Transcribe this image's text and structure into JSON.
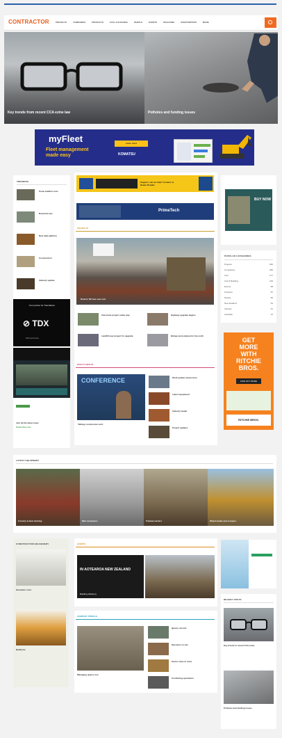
{
  "brand": {
    "logo_text": "CONTRACTOR",
    "accent": "#f06b22",
    "link_blue": "#2a5fa8"
  },
  "nav": {
    "items": [
      "PROJECTS",
      "COMPANIES",
      "PRODUCTS",
      "CIVIL & BUILDING",
      "PEOPLE",
      "EVENTS",
      "MAGAZINE",
      "SUBSCRIPTION",
      "MORE"
    ]
  },
  "hero": [
    {
      "title": "Key trends from recent CCA ezine law",
      "meta": ""
    },
    {
      "title": "Potholes and funding issues",
      "meta": ""
    }
  ],
  "banner1": {
    "title": "myFleet",
    "subtitle_line1": "Fleet management",
    "subtitle_line2": "made easy",
    "button": "Learn more",
    "brand": "KOMATSU"
  },
  "sidebar_left": {
    "heading": "TRENDING",
    "items": [
      "Some builders now",
      "Road bid new",
      "New data platform",
      "Construction",
      "Industry update"
    ]
  },
  "tdx_ad": {
    "top_text": "Your partner for TransDecal",
    "logo": "TDX",
    "bottom_text": "Find out more"
  },
  "ad_subscribe": {
    "line1": "Join all the latest news",
    "line2": "Subscribe now"
  },
  "mid_ads": [
    {
      "text": "Support, can we help? Contact us Dealer Rentals"
    },
    {
      "text": "PrimeTech"
    }
  ],
  "projects_section": {
    "label": "PROJECTS",
    "feature_caption": "Road in NZ was sees end",
    "items": [
      {
        "title": "Fast-track project under way",
        "date": ""
      },
      {
        "title": "Highway upgrade begins",
        "date": ""
      },
      {
        "title": "Landfill new project for upgrade",
        "date": ""
      },
      {
        "title": "Bridge work planned in the north",
        "date": ""
      }
    ]
  },
  "videos_section": {
    "label": "WHAT'S NEW IN",
    "feature_title": "Talking construction tech",
    "feature_caption": "CONFERENCE",
    "items": [
      "Work update shown here",
      "Latest equipment",
      "Industry leader",
      "Project updates"
    ]
  },
  "right_top_ad": {
    "label": "BUY NOW"
  },
  "categories": {
    "heading": "POPULAR CATEGORIES",
    "rows": [
      {
        "name": "Projects",
        "count": "290"
      },
      {
        "name": "Companies",
        "count": "283"
      },
      {
        "name": "Civil",
        "count": "177"
      },
      {
        "name": "Civil & Building",
        "count": "146"
      },
      {
        "name": "Events",
        "count": "98"
      },
      {
        "name": "Products",
        "count": "87"
      },
      {
        "name": "People",
        "count": "66"
      },
      {
        "name": "New Zealand",
        "count": "53"
      },
      {
        "name": "Industry",
        "count": "31"
      },
      {
        "name": "Australia",
        "count": "12"
      }
    ]
  },
  "ritchie_ad": {
    "line1": "GET",
    "line2": "MORE",
    "line3": "WITH",
    "line4": "RITCHIE",
    "line5": "BROS.",
    "button": "FIND OUT MORE",
    "logo": "RITCHIE BROS."
  },
  "latest": {
    "heading": "LATEST EQUIPMENT",
    "tiles": [
      {
        "caption": "Forestry & land clearing"
      },
      {
        "caption": "Mini excavators"
      },
      {
        "caption": "Tracked carriers"
      },
      {
        "caption": "Wheel loader and scrapers"
      }
    ]
  },
  "bottom_left": {
    "heading": "CONSTRUCTION MACHINERY",
    "item1": "Excavator rows",
    "item2": "Bulldozer"
  },
  "bottom_mid": {
    "label": "EVENTS",
    "feature_caption": "IN AOTEAROA NEW ZEALAND",
    "feature_title": "Building efficiency",
    "side_caption": ""
  },
  "bottom_mid2": {
    "label": "COMPANY PROFILE",
    "feature_title": "Managing quarry rest",
    "items": [
      "Quarry records",
      "Operators in site",
      "Sector news in store",
      "Continuing operations"
    ]
  },
  "bottom_right": {
    "heading": "RECENT POSTS",
    "item1": "Key trends in recent CCA ezine",
    "item2": "Potholes and funding issues"
  }
}
